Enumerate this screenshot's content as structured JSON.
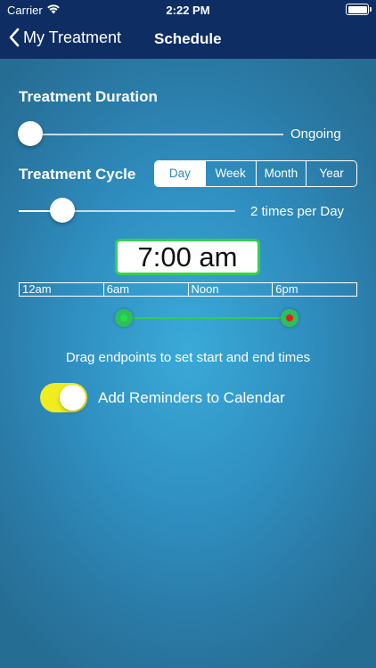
{
  "status_bar": {
    "carrier": "Carrier",
    "time": "2:22 PM",
    "wifi_icon": "wifi-icon",
    "battery_icon": "battery-icon"
  },
  "nav": {
    "back_label": "My Treatment",
    "title": "Schedule",
    "back_icon": "chevron-left-icon"
  },
  "duration": {
    "title": "Treatment Duration",
    "value_label": "Ongoing",
    "slider_fraction": 0.0
  },
  "cycle": {
    "title": "Treatment Cycle",
    "segments": [
      "Day",
      "Week",
      "Month",
      "Year"
    ],
    "selected": "Day",
    "value_label": "2 times per Day",
    "slider_fraction": 0.2
  },
  "time_picker": {
    "value": "7:00 am"
  },
  "timeline": {
    "labels": [
      "12am",
      "6am",
      "Noon",
      "6pm"
    ]
  },
  "range": {
    "start_color": "#22e04a",
    "end_color": "#e02020"
  },
  "hint": "Drag endpoints to set start and end times",
  "reminders": {
    "label": "Add Reminders to Calendar",
    "enabled": true,
    "toggle_color": "#f1ec20"
  },
  "colors": {
    "nav_background": "#0d2d63",
    "accent_green": "#36d14a"
  }
}
